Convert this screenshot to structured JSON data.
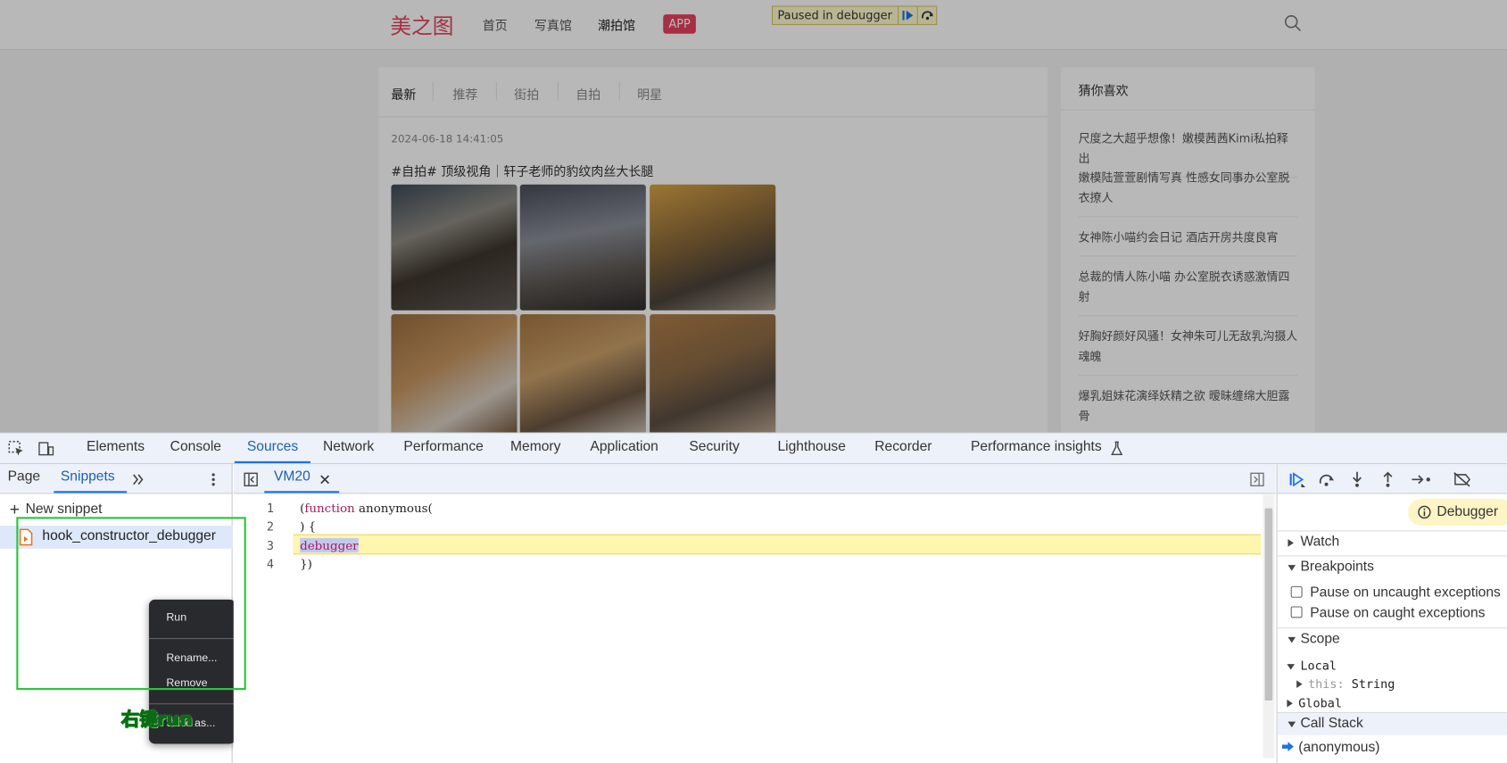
{
  "webpage": {
    "logo": "美之图",
    "nav": [
      "首页",
      "写真馆",
      "潮拍馆"
    ],
    "app_badge": "APP",
    "paused_text": "Paused in debugger",
    "post_tabs": [
      "最新",
      "推荐",
      "街拍",
      "自拍",
      "明星"
    ],
    "post_date": "2024-06-18 14:41:05",
    "post_title": "#自拍#  顶级视角｜轩子老师的豹纹肉丝大长腿",
    "sidebar_title": "猜你喜欢",
    "sidebar_items": [
      "尺度之大超乎想像！嫩模茜茜Kimi私拍释出",
      "嫩模陆萱萱剧情写真 性感女同事办公室脱衣撩人",
      "女神陈小喵约会日记 酒店开房共度良宵",
      "总裁的情人陈小喵 办公室脱衣诱惑激情四射",
      "好胸好颜好风骚！女神朱可儿无敌乳沟摄人魂魄",
      "爆乳姐妹花演绎妖精之欲 暧昧缠绵大胆露骨"
    ]
  },
  "devtools": {
    "tabs": [
      "Elements",
      "Console",
      "Sources",
      "Network",
      "Performance",
      "Memory",
      "Application",
      "Security",
      "Lighthouse",
      "Recorder",
      "Performance insights"
    ],
    "active_tab": "Sources",
    "navigator_tabs": [
      "Page",
      "Snippets"
    ],
    "new_snippet": "New snippet",
    "snippet_name": "hook_constructor_debugger",
    "context_menu": [
      "Run",
      "Rename...",
      "Remove",
      "Save as..."
    ],
    "annotation": "右键run",
    "file_tab": "VM20",
    "code_lines": [
      {
        "num": "1",
        "text": "(function anonymous("
      },
      {
        "num": "2",
        "text": ") {"
      },
      {
        "num": "3",
        "text": "debugger"
      },
      {
        "num": "4",
        "text": "})"
      }
    ],
    "debugger_badge": "Debugger",
    "sections": {
      "watch": "Watch",
      "breakpoints": "Breakpoints",
      "pause_uncaught": "Pause on uncaught exceptions",
      "pause_caught": "Pause on caught exceptions",
      "scope": "Scope",
      "local": "Local",
      "this_key": "this",
      "this_val": "String",
      "global": "Global",
      "call_stack": "Call Stack",
      "frame": "(anonymous)"
    }
  }
}
